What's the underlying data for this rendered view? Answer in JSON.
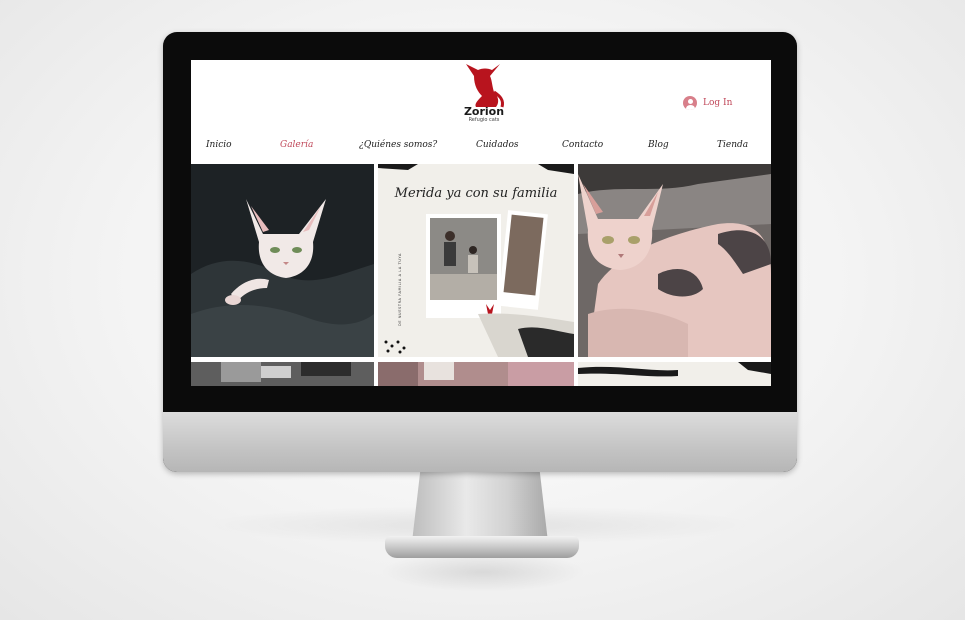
{
  "logo": {
    "name": "Zorion",
    "subtitle": "Refugio cats"
  },
  "header": {
    "login_label": "Log In"
  },
  "nav": {
    "items": [
      {
        "label": "Inicio"
      },
      {
        "label": "Galería"
      },
      {
        "label": "¿Quiénes somos?"
      },
      {
        "label": "Cuidados"
      },
      {
        "label": "Contacto"
      },
      {
        "label": "Blog"
      },
      {
        "label": "Tienda"
      }
    ],
    "active_index": 1
  },
  "gallery": {
    "poster": {
      "title": "Merida ya con su familia",
      "side_text": "DE NUESTRA FAMILIA A LA TUYA"
    }
  },
  "colors": {
    "accent": "#c0485a",
    "logo_red": "#b8141e",
    "bezel": "#0b0b0b"
  }
}
